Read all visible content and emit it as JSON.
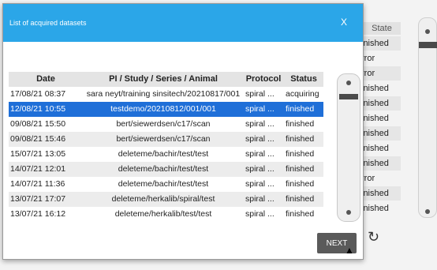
{
  "dialog": {
    "title": "List of acquired datasets",
    "close_label": "X",
    "next_label": "NEXT"
  },
  "table": {
    "headers": [
      "Date",
      "PI / Study / Series / Animal",
      "Protocol",
      "Status"
    ],
    "rows": [
      {
        "date": "17/08/21 08:37",
        "path": "sara neyt/training sinsitech/20210817/001",
        "protocol": "spiral ...",
        "status": "acquiring"
      },
      {
        "date": "12/08/21 10:55",
        "path": "testdemo/20210812/001/001",
        "protocol": "spiral ...",
        "status": "finished"
      },
      {
        "date": "09/08/21 15:50",
        "path": "bert/siewerdsen/c17/scan",
        "protocol": "spiral ...",
        "status": "finished"
      },
      {
        "date": "09/08/21 15:46",
        "path": "bert/siewerdsen/c17/scan",
        "protocol": "spiral ...",
        "status": "finished"
      },
      {
        "date": "15/07/21 13:05",
        "path": "deleteme/bachir/test/test",
        "protocol": "spiral ...",
        "status": "finished"
      },
      {
        "date": "14/07/21 12:01",
        "path": "deleteme/bachir/test/test",
        "protocol": "spiral ...",
        "status": "finished"
      },
      {
        "date": "14/07/21 11:36",
        "path": "deleteme/bachir/test/test",
        "protocol": "spiral ...",
        "status": "finished"
      },
      {
        "date": "13/07/21 17:07",
        "path": "deleteme/herkalib/spiral/test",
        "protocol": "spiral ...",
        "status": "finished"
      },
      {
        "date": "13/07/21 16:12",
        "path": "deleteme/herkalib/test/test",
        "protocol": "spiral ...",
        "status": "finished"
      }
    ],
    "selected_index": 1
  },
  "background": {
    "state_header": "State",
    "state_cells": [
      "inished",
      "rror",
      "rror",
      "inished",
      "inished",
      "inished",
      "inished",
      "inished",
      "inished",
      "rror",
      "inished",
      "inished"
    ]
  },
  "icons": {
    "close": "close-icon",
    "refresh": "refresh-icon",
    "cursor": "cursor-icon"
  },
  "colors": {
    "header": "#2ba6e8",
    "selected_row": "#1f6fd8",
    "next_button": "#5a5a5a"
  }
}
